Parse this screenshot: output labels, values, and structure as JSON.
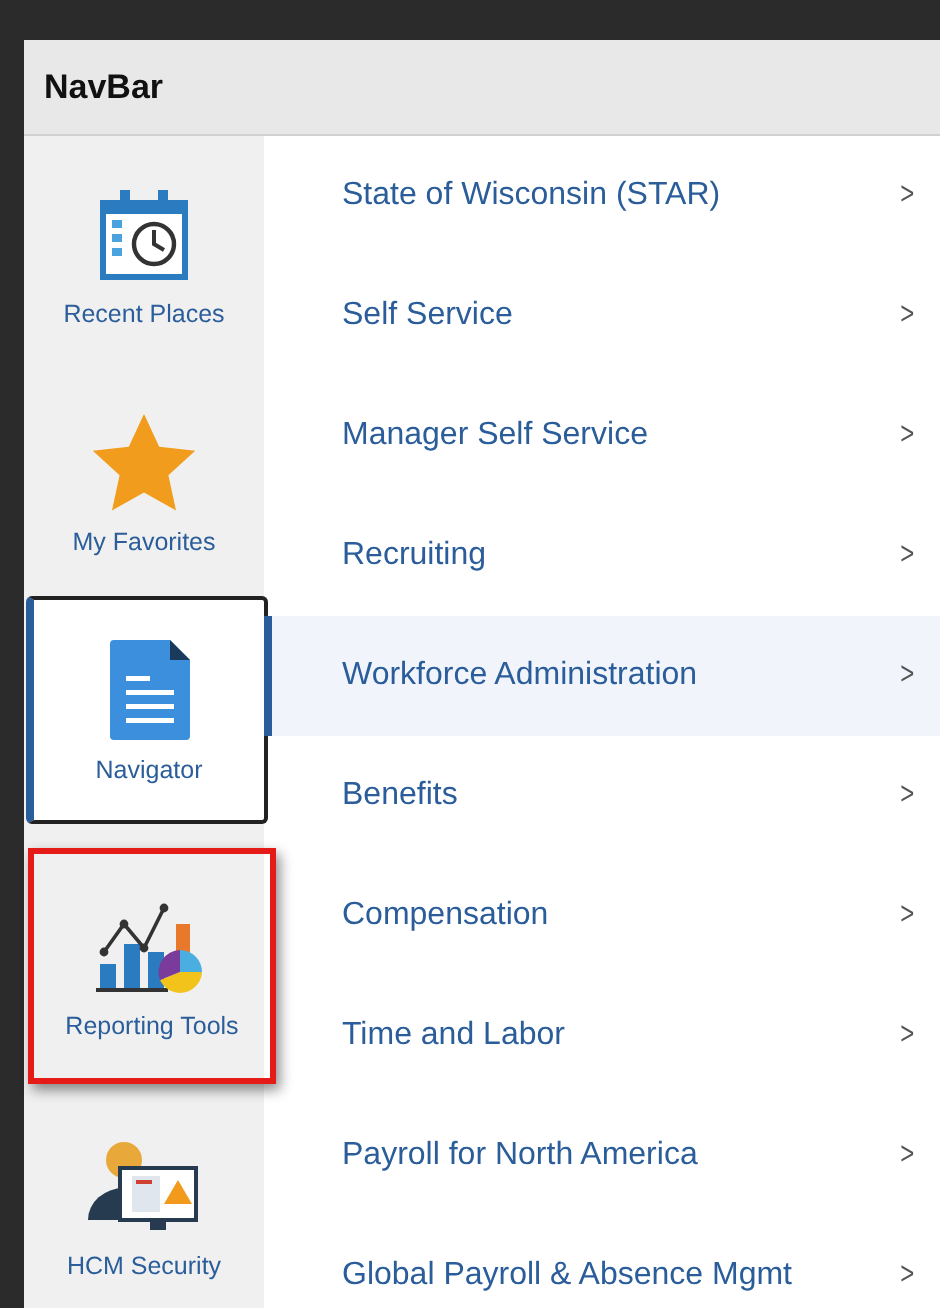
{
  "window": {
    "title": "NavBar"
  },
  "tiles": [
    {
      "label": "Recent Places",
      "kind": "calendar",
      "selected": false,
      "highlighted": false
    },
    {
      "label": "My Favorites",
      "kind": "star",
      "selected": false,
      "highlighted": false
    },
    {
      "label": "Navigator",
      "kind": "document",
      "selected": true,
      "highlighted": false
    },
    {
      "label": "Reporting Tools",
      "kind": "chart",
      "selected": false,
      "highlighted": true
    },
    {
      "label": "HCM Security",
      "kind": "security",
      "selected": false,
      "highlighted": false
    }
  ],
  "menu": [
    {
      "label": "State of Wisconsin (STAR)",
      "chevron": ">",
      "selected": false
    },
    {
      "label": "Self Service",
      "chevron": ">",
      "selected": false
    },
    {
      "label": "Manager Self Service",
      "chevron": ">",
      "selected": false
    },
    {
      "label": "Recruiting",
      "chevron": ">",
      "selected": false
    },
    {
      "label": "Workforce Administration",
      "chevron": ">",
      "selected": true
    },
    {
      "label": "Benefits",
      "chevron": ">",
      "selected": false
    },
    {
      "label": "Compensation",
      "chevron": ">",
      "selected": false
    },
    {
      "label": "Time and Labor",
      "chevron": ">",
      "selected": false
    },
    {
      "label": "Payroll for North America",
      "chevron": ">",
      "selected": false
    },
    {
      "label": "Global Payroll & Absence Mgmt",
      "chevron": ">",
      "selected": false
    }
  ]
}
